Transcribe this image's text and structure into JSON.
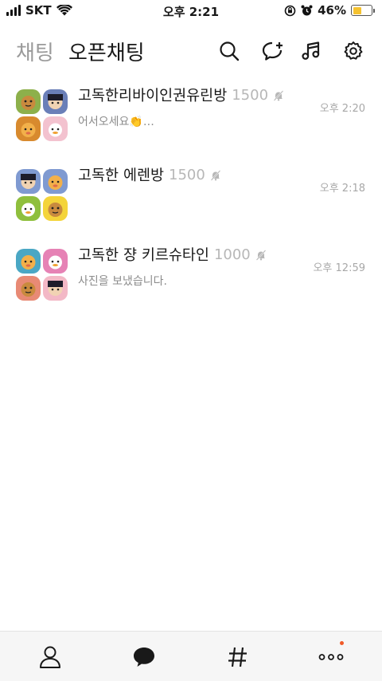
{
  "status_bar": {
    "carrier": "SKT",
    "time": "오후 2:21",
    "battery": "46%",
    "battery_level": 0.46,
    "battery_color": "#f5c230",
    "icons": [
      "signal-icon",
      "wifi-icon",
      "rotation-lock-icon",
      "alarm-icon",
      "battery-icon"
    ]
  },
  "header": {
    "tab_chat": "채팅",
    "tab_open_chat": "오픈채팅",
    "icons": [
      "search-icon",
      "new-chat-icon",
      "music-icon",
      "settings-icon"
    ]
  },
  "chats": [
    {
      "title": "고독한리바이인권유린방",
      "members": "1500",
      "muted": true,
      "preview": "어서오세요👏…",
      "time": "오후 2:20",
      "avatars": [
        "#8db04b",
        "#6a7fb8",
        "#d88a2e",
        "#f3c2cf"
      ]
    },
    {
      "title": "고독한 에렌방",
      "members": "1500",
      "muted": true,
      "preview": "",
      "time": "오후 2:18",
      "avatars": [
        "#7f9ad1",
        "#7f9ad1",
        "#8fbf3d",
        "#f4d43a"
      ]
    },
    {
      "title": "고독한 쟝 키르슈타인",
      "members": "1000",
      "muted": true,
      "preview": "사진을 보냈습니다.",
      "time": "오후 12:59",
      "avatars": [
        "#4aa7c4",
        "#e682b5",
        "#e88a75",
        "#f3b8c6"
      ]
    }
  ],
  "bottom_nav": {
    "items": [
      "friends-icon",
      "chats-icon",
      "openchat-hashtag-icon",
      "more-icon"
    ],
    "notification_color": "#f05a28"
  }
}
